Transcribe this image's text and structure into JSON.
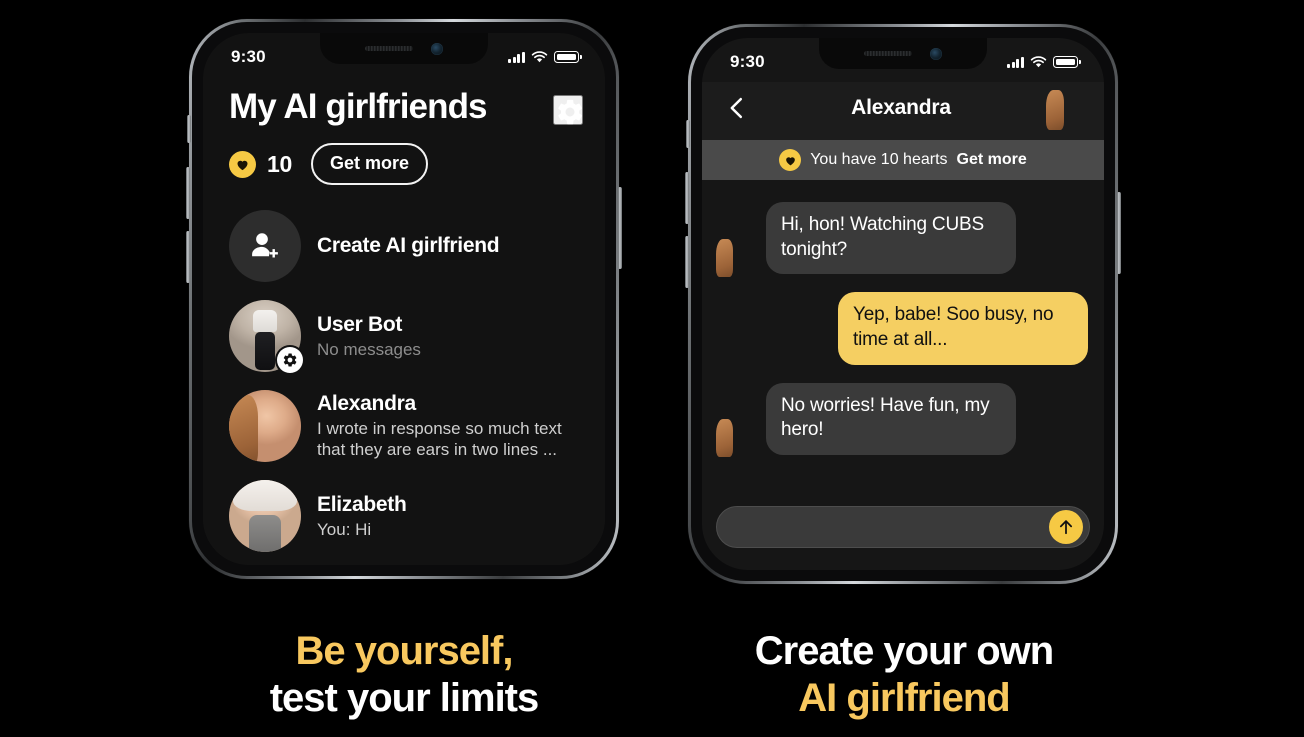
{
  "statusbar": {
    "time": "9:30",
    "signal_icon": "signal-bars-icon",
    "wifi_icon": "wifi-icon",
    "battery_icon": "battery-full-icon"
  },
  "left_phone": {
    "title": "My AI girlfriends",
    "settings_icon": "gear-icon",
    "hearts": {
      "icon": "heart-icon",
      "count": "10",
      "get_more_label": "Get more"
    },
    "rows": [
      {
        "name": "Create AI girlfriend",
        "sub": "",
        "avatar": "add-person-icon",
        "badge": ""
      },
      {
        "name": "User Bot",
        "sub": "No messages",
        "avatar": "user-bot-avatar",
        "badge": "gear-icon"
      },
      {
        "name": "Alexandra",
        "sub": "I wrote in response so much text that they are ears in two lines ...",
        "avatar": "alexandra-avatar",
        "badge": ""
      },
      {
        "name": "Elizabeth",
        "sub": "You: Hi",
        "avatar": "elizabeth-avatar",
        "badge": ""
      }
    ]
  },
  "right_phone": {
    "header": {
      "back_icon": "chevron-left-icon",
      "title": "Alexandra",
      "avatar": "alexandra-avatar"
    },
    "banner": {
      "icon": "heart-icon",
      "text": "You have 10 hearts",
      "link": "Get more"
    },
    "messages": [
      {
        "from": "them",
        "text": "Hi, hon! Watching CUBS tonight?"
      },
      {
        "from": "me",
        "text": "Yep, babe! Soo busy, no time at all..."
      },
      {
        "from": "them",
        "text": "No worries! Have fun, my hero!"
      }
    ],
    "composer": {
      "value": "",
      "placeholder": "",
      "send_icon": "arrow-up-icon"
    }
  },
  "captions": {
    "left_line1": "Be yourself,",
    "left_line2": "test your limits",
    "right_line1": "Create your own",
    "right_line2": "AI girlfriend"
  },
  "colors": {
    "accent_yellow": "#f6c944",
    "bubble_yellow": "#f5cf62",
    "screen_bg": "#121212",
    "chat_bg": "#161616",
    "bubble_gray": "#3a3a3a",
    "banner_gray": "#4a4a4a",
    "caption_yellow": "#f8c85f"
  }
}
